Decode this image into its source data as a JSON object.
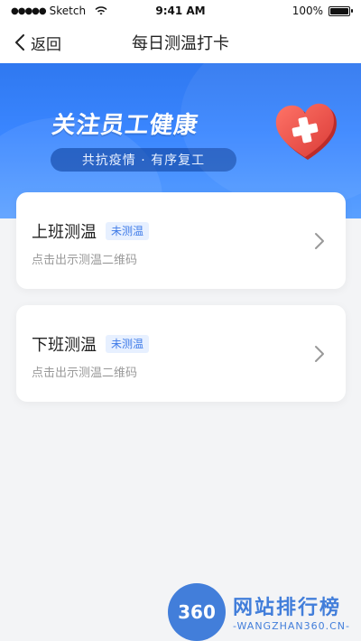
{
  "status_bar": {
    "carrier": "Sketch",
    "time": "9:41 AM",
    "battery": "100%",
    "battery_level": 1.0
  },
  "nav": {
    "back_label": "返回",
    "title": "每日测温打卡"
  },
  "banner": {
    "headline": "关注员工健康",
    "slogan": "共抗疫情 · 有序复工"
  },
  "cards": [
    {
      "title": "上班测温",
      "badge": "未测温",
      "hint": "点击出示测温二维码"
    },
    {
      "title": "下班测温",
      "badge": "未测温",
      "hint": "点击出示测温二维码"
    }
  ],
  "watermark": {
    "badge": "360",
    "name": "网站排行榜",
    "domain": "-WANGZHAN360.CN-"
  },
  "colors": {
    "primary_blue": "#3a86ff",
    "badge_text": "#3f7be8",
    "badge_bg": "#e7f0ff",
    "heart_red": "#e8463f"
  }
}
